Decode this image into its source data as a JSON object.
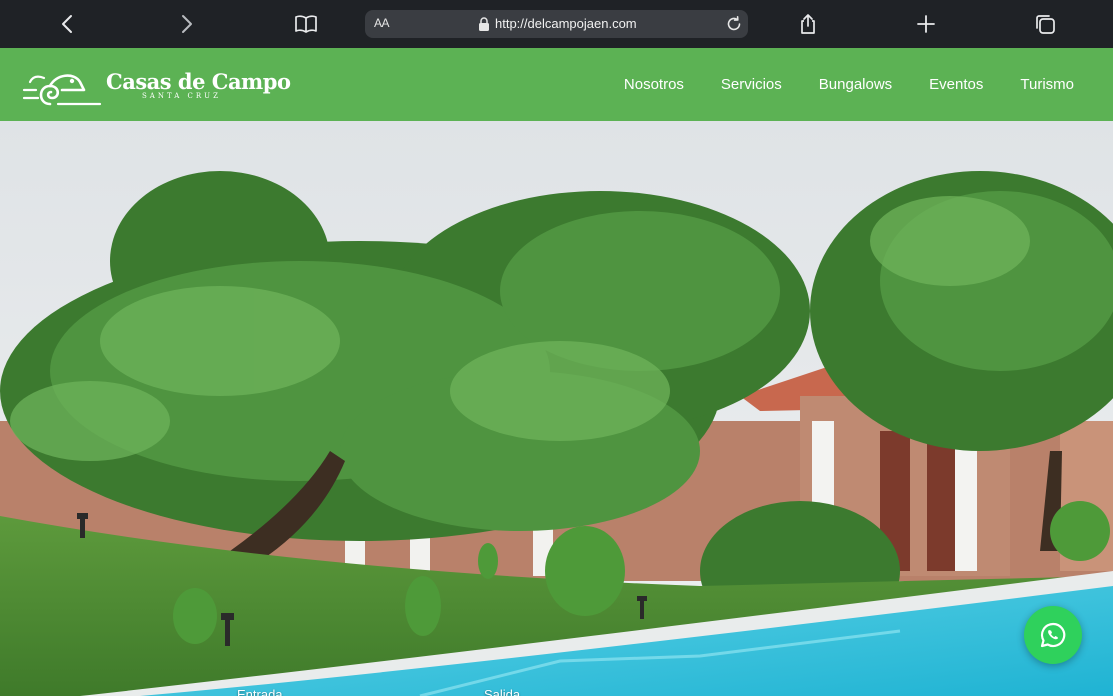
{
  "browser": {
    "aa_label": "AA",
    "url": "http://delcampojaen.com",
    "icons": [
      "back-icon",
      "forward-icon",
      "bookmarks-icon",
      "lock-icon",
      "reload-icon",
      "share-icon",
      "new-tab-icon",
      "tabs-icon"
    ]
  },
  "site": {
    "logo_title": "Casas de Campo",
    "logo_subtitle": "SANTA CRUZ",
    "nav": [
      "Nosotros",
      "Servicios",
      "Bungalows",
      "Eventos",
      "Turismo"
    ],
    "brand_color": "#5cb254"
  },
  "booking": {
    "checkin_label": "Entrada",
    "checkout_label": "Salida"
  },
  "whatsapp": {
    "icon": "whatsapp-icon",
    "color": "#2fd15c"
  }
}
